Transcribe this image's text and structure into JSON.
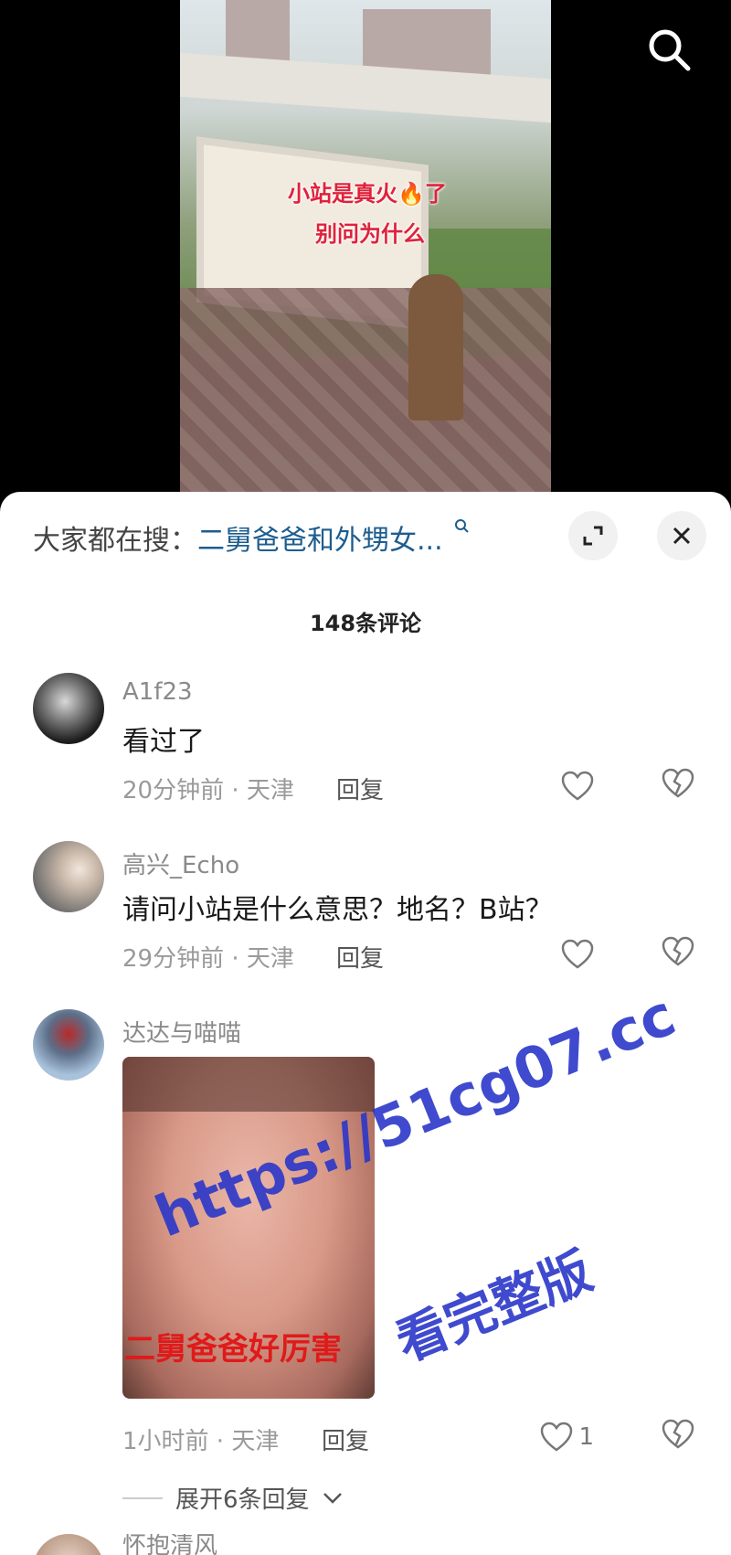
{
  "video": {
    "overlay_line1": "小站是真火🔥了",
    "overlay_line2": "别问为什么"
  },
  "sheet": {
    "search_prefix": "大家都在搜：",
    "search_keyword": "二舅爸爸和外甥女...",
    "comment_count": "148条评论"
  },
  "comments": [
    {
      "user": "A1f23",
      "text": "看过了",
      "time_location": "20分钟前 · 天津",
      "reply_label": "回复"
    },
    {
      "user": "高兴_Echo",
      "text": "请问小站是什么意思？地名？B站？",
      "time_location": "29分钟前 · 天津",
      "reply_label": "回复"
    },
    {
      "user": "达达与喵喵",
      "image_caption": "二舅爸爸好厉害",
      "time_location": "1小时前 · 天津",
      "reply_label": "回复",
      "like_count": "1",
      "expand_label": "展开6条回复"
    },
    {
      "user": "怀抱清风"
    }
  ],
  "watermark": {
    "line1": "https://51cg07.cc",
    "line2": "看完整版"
  },
  "colors": {
    "keyword": "#1d5d8f",
    "watermark": "#2b37c9"
  }
}
